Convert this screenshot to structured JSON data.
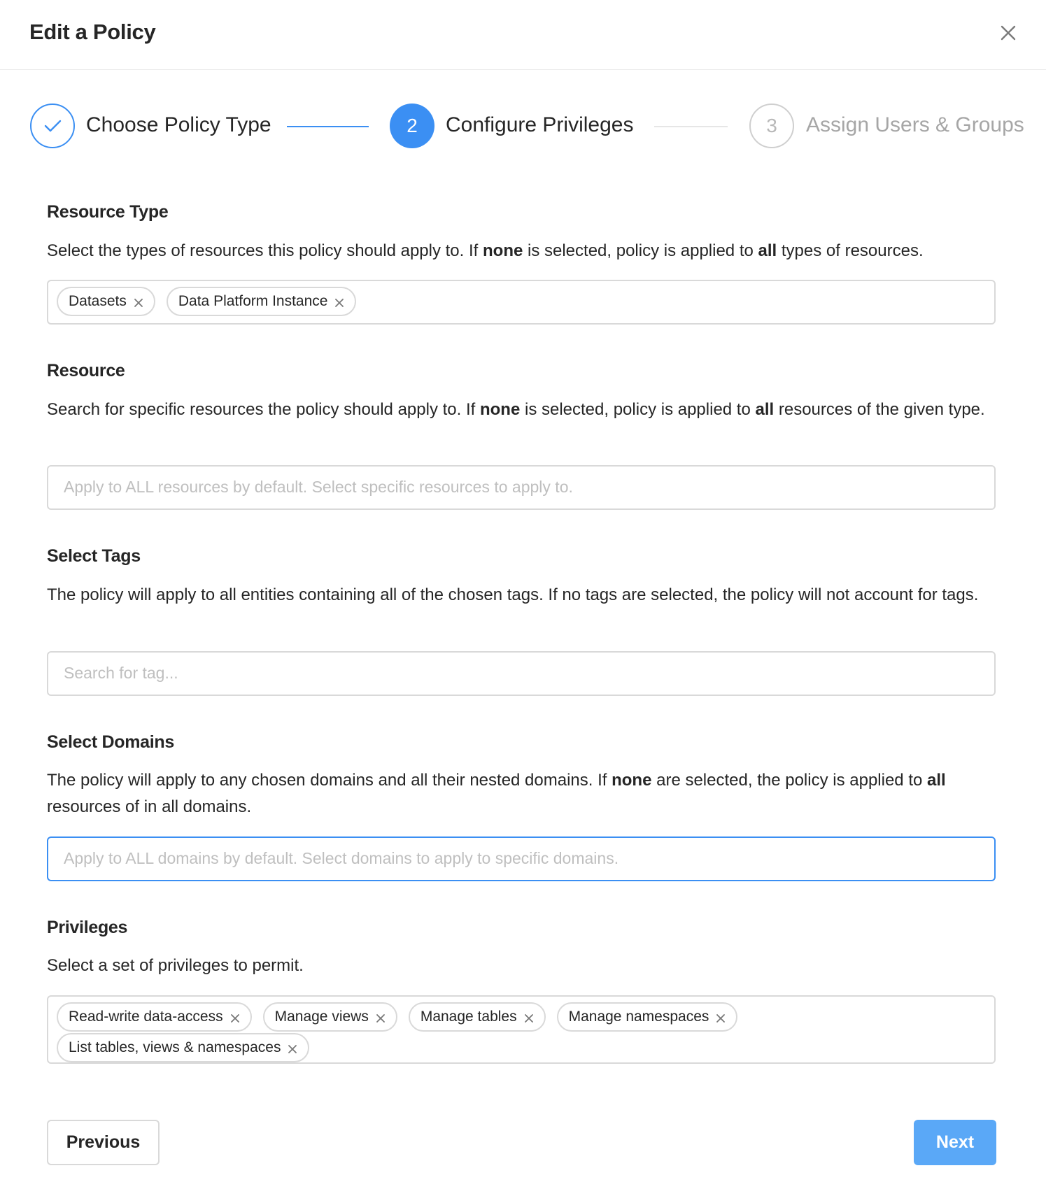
{
  "modal": {
    "title": "Edit a Policy"
  },
  "steps": [
    {
      "number": "1",
      "label": "Choose Policy Type",
      "state": "done"
    },
    {
      "number": "2",
      "label": "Configure Privileges",
      "state": "active"
    },
    {
      "number": "3",
      "label": "Assign Users & Groups",
      "state": "pending"
    }
  ],
  "resource_type": {
    "title": "Resource Type",
    "desc_1": "Select the types of resources this policy should apply to. If ",
    "desc_b1": "none",
    "desc_2": " is selected, policy is applied to ",
    "desc_b2": "all",
    "desc_3": " types of resources.",
    "tags": [
      "Datasets",
      "Data Platform Instance"
    ]
  },
  "resource": {
    "title": "Resource",
    "desc_1": "Search for specific resources the policy should apply to. If ",
    "desc_b1": "none",
    "desc_2": " is selected, policy is applied to ",
    "desc_b2": "all",
    "desc_3": " resources of the given type.",
    "placeholder": "Apply to ALL resources by default. Select specific resources to apply to."
  },
  "tags_section": {
    "title": "Select Tags",
    "desc": "The policy will apply to all entities containing all of the chosen tags. If no tags are selected, the policy will not account for tags.",
    "placeholder": "Search for tag..."
  },
  "domains": {
    "title": "Select Domains",
    "desc_1": "The policy will apply to any chosen domains and all their nested domains. If ",
    "desc_b1": "none",
    "desc_2": " are selected, the policy is applied to ",
    "desc_b2": "all",
    "desc_3": " resources of in all domains.",
    "placeholder": "Apply to ALL domains by default. Select domains to apply to specific domains."
  },
  "privileges": {
    "title": "Privileges",
    "desc": "Select a set of privileges to permit.",
    "tags": [
      "Read-write data-access",
      "Manage views",
      "Manage tables",
      "Manage namespaces",
      "List tables, views & namespaces"
    ]
  },
  "footer": {
    "previous": "Previous",
    "next": "Next"
  },
  "colors": {
    "accent": "#3b8ff3",
    "next_button": "#5aa8f7",
    "border": "#d9d9d9"
  }
}
